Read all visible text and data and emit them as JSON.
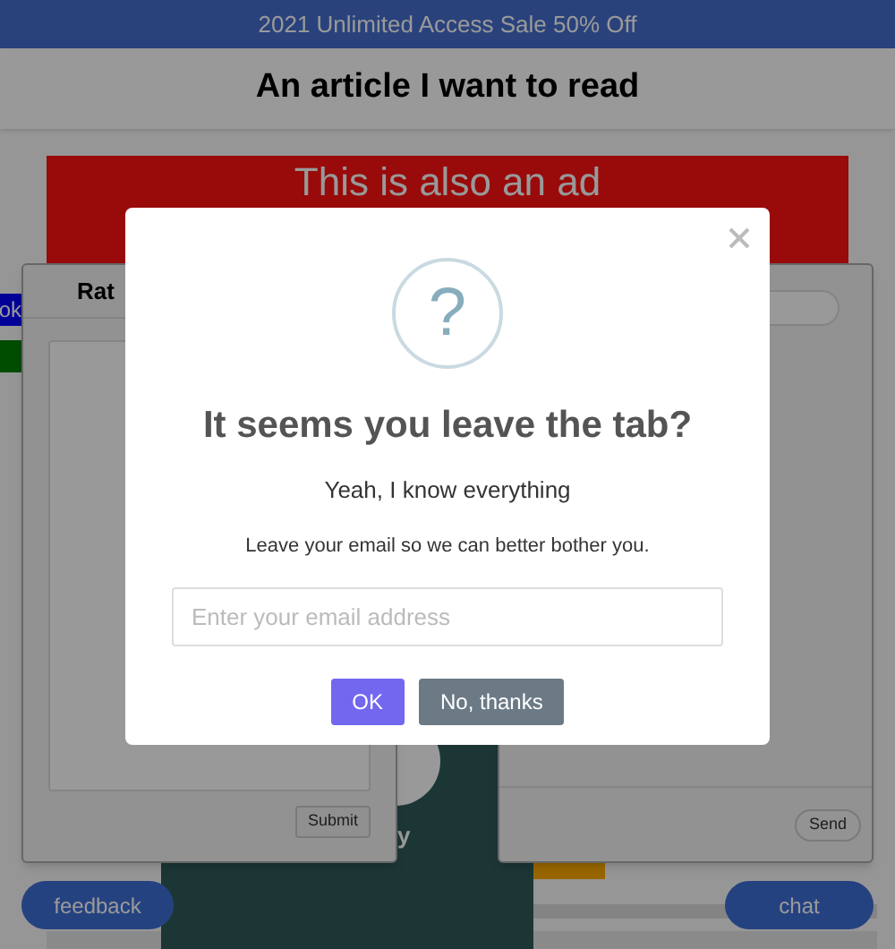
{
  "banner": {
    "text": "2021 Unlimited Access Sale 50% Off"
  },
  "header": {
    "title": "An article I want to read"
  },
  "ad": {
    "text": "This is also an ad"
  },
  "side_tab": {
    "label": "ok"
  },
  "feedback_panel": {
    "title": "Rat",
    "submit": "Submit"
  },
  "chat_panel": {
    "send": "Send"
  },
  "card": {
    "text": "y"
  },
  "feedback_button": "feedback",
  "chat_button": "chat",
  "modal": {
    "icon": "?",
    "title": "It seems you leave the tab?",
    "subtitle": "Yeah, I know everything",
    "message": "Leave your email so we can better bother you.",
    "email_field": {
      "placeholder": "Enter your email address"
    },
    "buttons": [
      {
        "label": "OK",
        "kind": "primary"
      },
      {
        "label": "No, thanks",
        "kind": "secondary"
      }
    ]
  }
}
